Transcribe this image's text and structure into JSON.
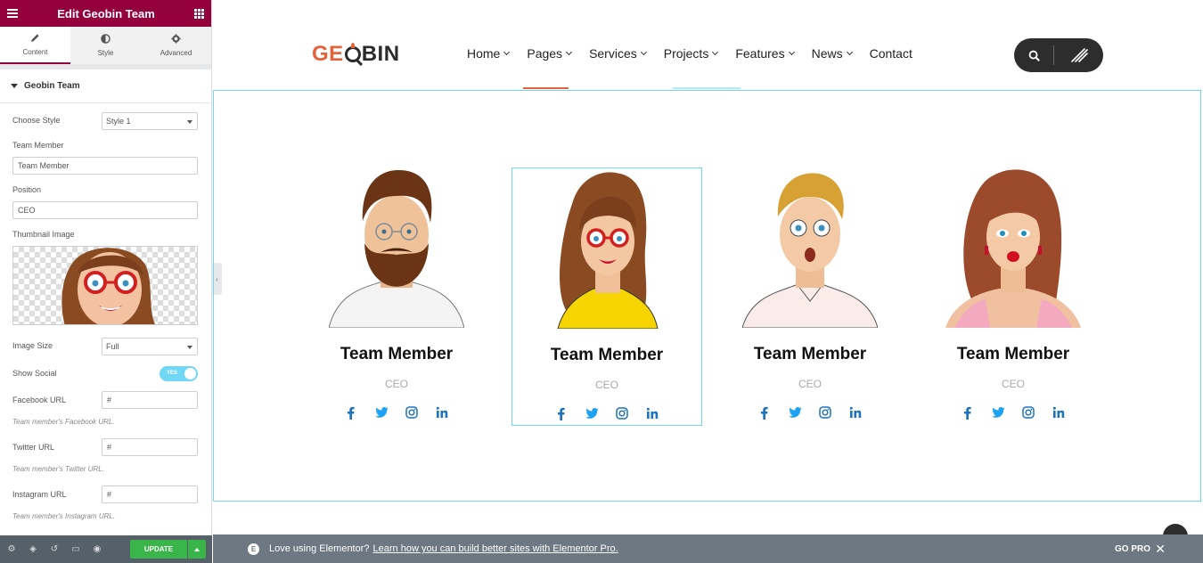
{
  "panel": {
    "title": "Edit Geobin Team",
    "tabs": [
      {
        "label": "Content",
        "icon": "pencil-icon",
        "active": true
      },
      {
        "label": "Style",
        "icon": "half-circle-icon",
        "active": false
      },
      {
        "label": "Advanced",
        "icon": "gear-icon",
        "active": false
      }
    ],
    "section_title": "Geobin Team",
    "controls": {
      "choose_style_label": "Choose Style",
      "choose_style_value": "Style 1",
      "team_member_label": "Team Member",
      "team_member_value": "Team Member",
      "position_label": "Position",
      "position_value": "CEO",
      "thumbnail_label": "Thumbnail Image",
      "image_size_label": "Image Size",
      "image_size_value": "Full",
      "show_social_label": "Show Social",
      "show_social_toggle": "YES",
      "facebook_label": "Facebook URL",
      "facebook_value": "#",
      "facebook_help": "Team member's Facebook URL.",
      "twitter_label": "Twitter URL",
      "twitter_value": "#",
      "twitter_help": "Team member's Twitter URL.",
      "instagram_label": "Instagram URL",
      "instagram_value": "#",
      "instagram_help": "Team member's Instagram URL."
    },
    "footer": {
      "update_label": "UPDATE"
    }
  },
  "site": {
    "logo": {
      "part1": "GE",
      "part2": "BIN"
    },
    "nav": [
      {
        "label": "Home",
        "has_dropdown": true
      },
      {
        "label": "Pages",
        "has_dropdown": true
      },
      {
        "label": "Services",
        "has_dropdown": true
      },
      {
        "label": "Projects",
        "has_dropdown": true
      },
      {
        "label": "Features",
        "has_dropdown": true
      },
      {
        "label": "News",
        "has_dropdown": true
      },
      {
        "label": "Contact",
        "has_dropdown": false
      }
    ],
    "team": [
      {
        "name": "Team Member",
        "position": "CEO",
        "avatar": "bearded-man"
      },
      {
        "name": "Team Member",
        "position": "CEO",
        "avatar": "woman-red-glasses"
      },
      {
        "name": "Team Member",
        "position": "CEO",
        "avatar": "surprised-man"
      },
      {
        "name": "Team Member",
        "position": "CEO",
        "avatar": "woman-red-lips"
      }
    ],
    "colors": {
      "accent": "#e5623b",
      "social_blue": "#1e73be",
      "twitter": "#1da1f2",
      "elementor": "#93003c",
      "selection": "#71d7f7"
    }
  },
  "promo": {
    "text": "Love using Elementor?",
    "link": "Learn how you can build better sites with Elementor Pro.",
    "go_pro": "GO PRO",
    "close": "✕"
  }
}
